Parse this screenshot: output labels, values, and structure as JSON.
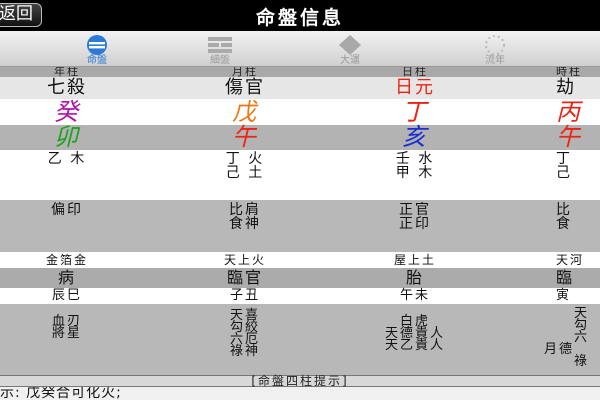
{
  "nav": {
    "back_label": "返回",
    "title": "命盤信息"
  },
  "tabs": [
    {
      "label": "命盤",
      "icon": "chart-circle-icon",
      "active": true
    },
    {
      "label": "細盤",
      "icon": "detail-grid-icon",
      "active": false
    },
    {
      "label": "大運",
      "icon": "diamond-icon",
      "active": false
    },
    {
      "label": "流年",
      "icon": "dotted-circle-icon",
      "active": false
    }
  ],
  "columns": {
    "headers": [
      "年柱",
      "月柱",
      "日柱",
      "時柱"
    ],
    "ten_gods": [
      "七殺",
      "傷官",
      "日元",
      "劫"
    ],
    "stems": [
      "癸",
      "戊",
      "丁",
      "丙"
    ],
    "branches": [
      "卯",
      "午",
      "亥",
      "午"
    ],
    "hidden_stems": [
      [
        "乙 木"
      ],
      [
        "丁 火",
        "己 土"
      ],
      [
        "壬 水",
        "甲 木"
      ],
      [
        "丁",
        "己"
      ]
    ],
    "hidden_gods": [
      [
        "偏印"
      ],
      [
        "比肩",
        "食神"
      ],
      [
        "正官",
        "正印"
      ],
      [
        "比",
        "食"
      ]
    ],
    "nayin": [
      "金箔金",
      "天上火",
      "屋上土",
      "天河"
    ],
    "life_stage": [
      "病",
      "臨官",
      "胎",
      "臨"
    ],
    "void": [
      "辰巳",
      "子丑",
      "午未",
      "寅"
    ],
    "shensha": [
      [
        "血刃",
        "將星"
      ],
      [
        "天喜",
        "勾絞",
        "六厄",
        "祿神"
      ],
      [
        "白虎",
        "天德貴人",
        "天乙貴人"
      ],
      [
        "天",
        "勾",
        "六",
        "月德",
        "祿"
      ]
    ]
  },
  "colors": {
    "red": "#ee2211",
    "orange": "#ee7711",
    "blue": "#1a2fd0",
    "green": "#1ea21e",
    "magenta": "#b311a8"
  },
  "hint": {
    "title": "[命盤四柱提示]",
    "text": "示: 戊癸合可化火;"
  }
}
